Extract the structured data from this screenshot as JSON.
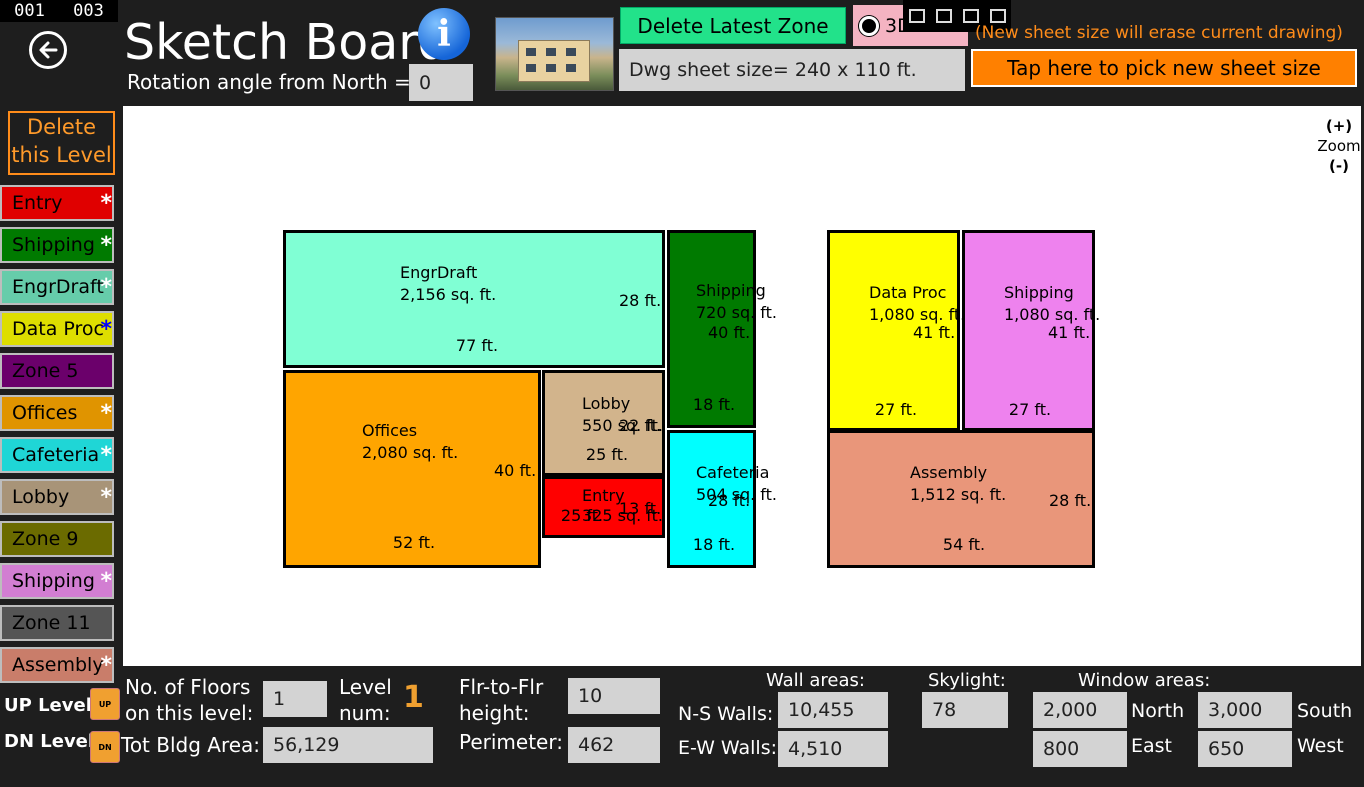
{
  "counter": {
    "left": "001",
    "right": "003"
  },
  "header": {
    "title": "Sketch Board",
    "rotation_label": "Rotation angle from North =",
    "rotation_value": "0",
    "delete_zone_label": "Delete Latest Zone",
    "view_3d_label": "3D",
    "warning": "(New sheet size will erase current drawing)",
    "sheet_size": "Dwg sheet size= 240 x 110 ft.",
    "pick_sheet_label": "Tap here to pick new sheet size"
  },
  "zoom": {
    "plus": "(+)",
    "label": "Zoom",
    "minus": "(-)"
  },
  "sidebar": {
    "delete_level": "Delete this Level",
    "zones": [
      {
        "label": "Entry",
        "color": "#e00000",
        "star": "*",
        "star_color": "#ffffff",
        "text_color": "#000000"
      },
      {
        "label": "Shipping",
        "color": "#007a00",
        "star": "*",
        "star_color": "#ffffff",
        "text_color": "#000000"
      },
      {
        "label": "EngrDraft",
        "color": "#66ccaa",
        "star": "*",
        "star_color": "#ffffff",
        "text_color": "#000000"
      },
      {
        "label": "Data Proc",
        "color": "#dede00",
        "star": "*",
        "star_color": "#0000ff",
        "text_color": "#000000"
      },
      {
        "label": "Zone 5",
        "color": "#6b006b",
        "star": "",
        "star_color": "#ffffff",
        "text_color": "#000000"
      },
      {
        "label": "Offices",
        "color": "#e09400",
        "star": "*",
        "star_color": "#ffffff",
        "text_color": "#000000"
      },
      {
        "label": "Cafeteria",
        "color": "#1fd6d6",
        "star": "*",
        "star_color": "#ffffff",
        "text_color": "#000000"
      },
      {
        "label": "Lobby",
        "color": "#a89478",
        "star": "*",
        "star_color": "#ffffff",
        "text_color": "#000000"
      },
      {
        "label": "Zone 9",
        "color": "#6b6b00",
        "star": "",
        "star_color": "#ffffff",
        "text_color": "#000000"
      },
      {
        "label": "Shipping",
        "color": "#d27ed2",
        "star": "*",
        "star_color": "#ffffff",
        "text_color": "#000000"
      },
      {
        "label": "Zone 11",
        "color": "#555555",
        "star": "",
        "star_color": "#ffffff",
        "text_color": "#000000"
      },
      {
        "label": "Assembly",
        "color": "#c97d6a",
        "star": "*",
        "star_color": "#ffffff",
        "text_color": "#000000"
      }
    ]
  },
  "rooms": [
    {
      "id": "engrdraft",
      "name": "EngrDraft",
      "area": "2,156 sq. ft.",
      "depth": "28 ft.",
      "width": "77 ft.",
      "color": "#80ffd4"
    },
    {
      "id": "shipping1",
      "name": "Shipping",
      "area": "720 sq. ft.",
      "depth": "40 ft.",
      "width": "18 ft.",
      "color": "#007a00"
    },
    {
      "id": "offices",
      "name": "Offices",
      "area": "2,080 sq. ft.",
      "depth": "40 ft.",
      "width": "52 ft.",
      "color": "#ffa500"
    },
    {
      "id": "lobby",
      "name": "Lobby",
      "area": "550 sq. ft.",
      "depth": "22 ft.",
      "width": "25 ft.",
      "color": "#d2b48c"
    },
    {
      "id": "entry",
      "name": "Entry",
      "area": "325 sq. ft.",
      "depth": "13 ft.",
      "width": "25 ft.",
      "color": "#ff0000"
    },
    {
      "id": "cafeteria",
      "name": "Cafeteria",
      "area": "504 sq. ft.",
      "depth": "28 ft.",
      "width": "18 ft.",
      "color": "#00ffff"
    },
    {
      "id": "dataproc",
      "name": "Data Proc",
      "area": "1,080 sq. ft.",
      "depth": "41 ft.",
      "width": "27 ft.",
      "color": "#ffff00"
    },
    {
      "id": "shipping2",
      "name": "Shipping",
      "area": "1,080 sq. ft.",
      "depth": "41 ft.",
      "width": "27 ft.",
      "color": "#ee82ee"
    },
    {
      "id": "assembly",
      "name": "Assembly",
      "area": "1,512 sq. ft.",
      "depth": "28 ft.",
      "width": "54 ft.",
      "color": "#e9967a"
    }
  ],
  "bottom": {
    "up_level": "UP Level",
    "dn_level": "DN Level",
    "up_icon": "UP",
    "dn_icon": "DN",
    "floors_label_1": "No. of Floors",
    "floors_label_2": "on this level:",
    "floors_value": "1",
    "level_label_1": "Level",
    "level_label_2": "num:",
    "level_value": "1",
    "tot_area_label": "Tot Bldg Area:",
    "tot_area_value": "56,129",
    "flr_label_1": "Flr-to-Flr",
    "flr_label_2": "height:",
    "flr_value": "10",
    "perimeter_label": "Perimeter:",
    "perimeter_value": "462",
    "wall_areas_label": "Wall areas:",
    "ns_label": "N-S Walls:",
    "ns_value": "10,455",
    "ew_label": "E-W Walls:",
    "ew_value": "4,510",
    "skylight_label": "Skylight:",
    "skylight_value": "78",
    "window_label": "Window areas:",
    "north_value": "2,000",
    "north_label": "North",
    "south_value": "3,000",
    "south_label": "South",
    "east_value": "800",
    "east_label": "East",
    "west_value": "650",
    "west_label": "West"
  }
}
